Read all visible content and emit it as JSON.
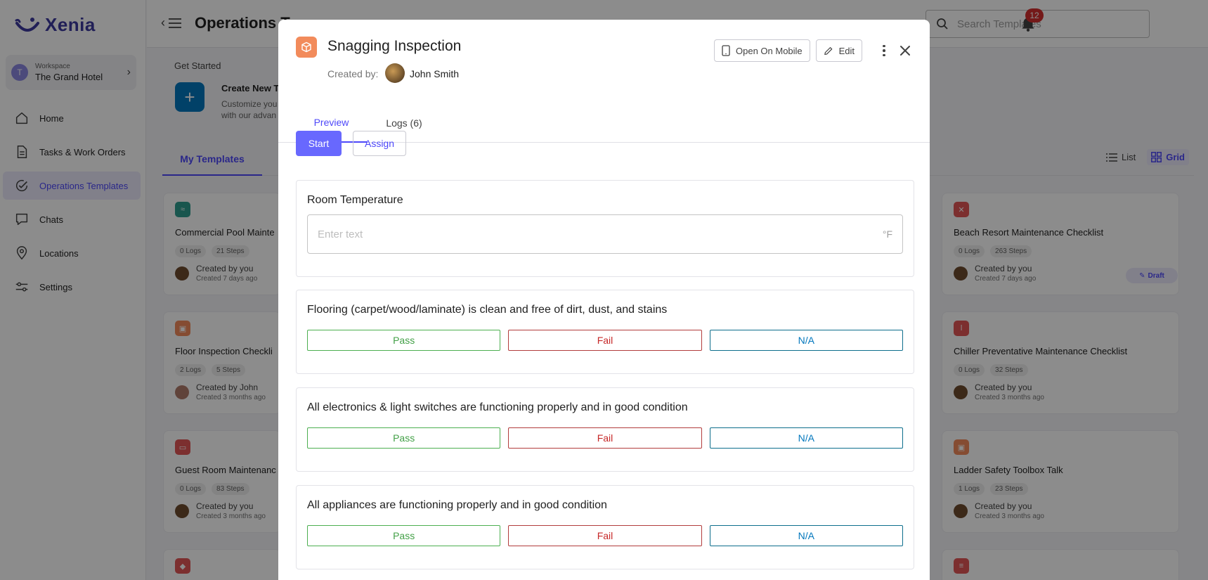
{
  "app": {
    "name": "Xenia"
  },
  "workspace": {
    "label": "Workspace",
    "name": "The Grand Hotel",
    "avatar_letter": "T"
  },
  "nav": [
    {
      "label": "Home",
      "icon": "home-icon"
    },
    {
      "label": "Tasks & Work Orders",
      "icon": "document-icon"
    },
    {
      "label": "Operations Templates",
      "icon": "check-circle-icon",
      "active": true
    },
    {
      "label": "Chats",
      "icon": "chat-icon"
    },
    {
      "label": "Locations",
      "icon": "location-pin-icon"
    },
    {
      "label": "Settings",
      "icon": "sliders-icon"
    }
  ],
  "header": {
    "title": "Operations T",
    "search_placeholder": "Search Templates",
    "notifications_count": "12"
  },
  "get_started": {
    "label": "Get Started",
    "create_title": "Create New T",
    "create_desc_1": "Customize you",
    "create_desc_2": "with our advan"
  },
  "templates_tab": "My Templates",
  "view": {
    "list": "List",
    "grid": "Grid"
  },
  "cards_left": [
    {
      "title": "Commercial Pool Mainte",
      "logs": "0 Logs",
      "steps": "21 Steps",
      "by": "Created by you",
      "when": "Created 7 days ago",
      "color": "#2e9d8f"
    },
    {
      "title": "Floor Inspection Checkli",
      "logs": "2 Logs",
      "steps": "5 Steps",
      "by": "Created by John",
      "when": "Created 3 months ago",
      "color": "#f28b5b"
    },
    {
      "title": "Guest Room Maintenanc",
      "logs": "0 Logs",
      "steps": "83 Steps",
      "by": "Created by you",
      "when": "Created 3 months ago",
      "color": "#e25757"
    }
  ],
  "cards_right": [
    {
      "title": "Beach Resort Maintenance Checklist",
      "logs": "0 Logs",
      "steps": "263 Steps",
      "by": "Created by you",
      "when": "Created 7 days ago",
      "color": "#e25757"
    },
    {
      "title": "Chiller Preventative Maintenance Checklist",
      "logs": "0 Logs",
      "steps": "32 Steps",
      "by": "Created by you",
      "when": "Created 3 months ago",
      "color": "#e25757"
    },
    {
      "title": "Ladder Safety Toolbox Talk",
      "logs": "1 Logs",
      "steps": "23 Steps",
      "by": "Created by you",
      "when": "Created 3 months ago",
      "color": "#f28b5b"
    }
  ],
  "draft_label": "Draft",
  "modal": {
    "title": "Snagging Inspection",
    "created_by_label": "Created by:",
    "author": "John Smith",
    "open_mobile": "Open On Mobile",
    "edit": "Edit",
    "tabs": [
      "Preview",
      "Logs (6)"
    ],
    "start": "Start",
    "assign": "Assign",
    "temperature": {
      "label": "Room Temperature",
      "placeholder": "Enter text",
      "unit": "°F"
    },
    "options": {
      "pass": "Pass",
      "fail": "Fail",
      "na": "N/A"
    },
    "steps": [
      "Flooring (carpet/wood/laminate) is clean and free of dirt, dust, and stains",
      "All electronics & light switches are functioning properly and in good condition",
      "All appliances are functioning properly and in good condition"
    ]
  }
}
